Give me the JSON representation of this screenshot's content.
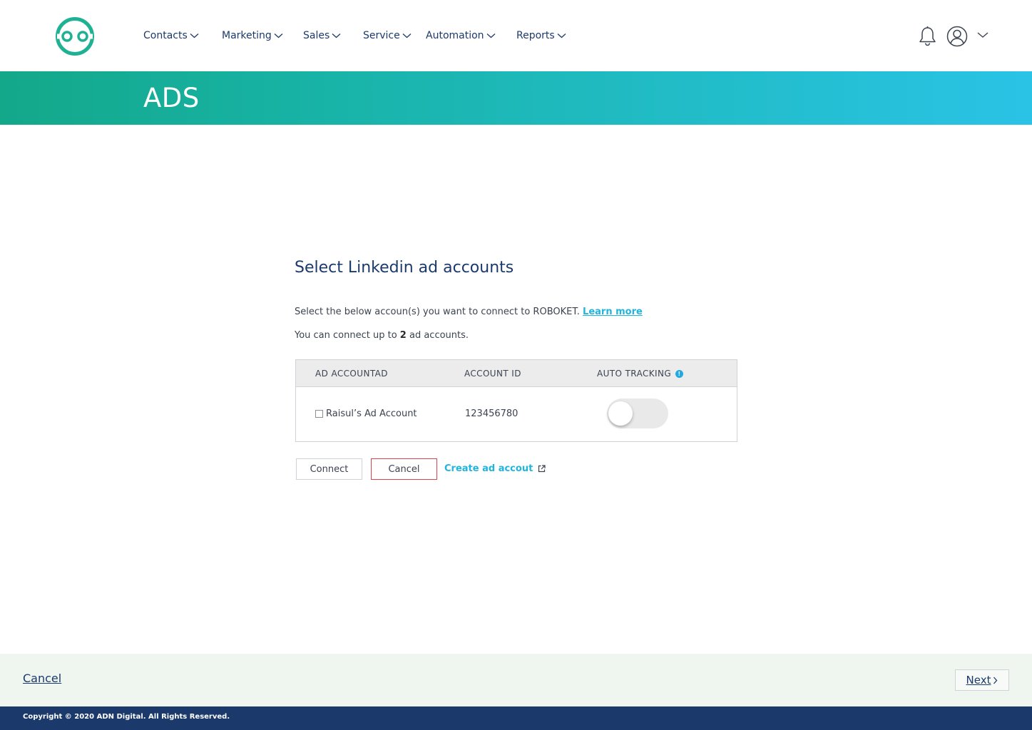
{
  "colors": {
    "brand_teal": "#13a88a",
    "brand_cyan": "#2ac3e6",
    "navy": "#1b3a6b",
    "link": "#21b5dc",
    "cancel_border": "#e0404a"
  },
  "header": {
    "logo_icon": "robot-face-logo",
    "nav": [
      {
        "label": "Contacts",
        "icon": "chevron-down-icon"
      },
      {
        "label": "Marketing",
        "icon": "chevron-down-icon"
      },
      {
        "label": "Sales",
        "icon": "chevron-down-icon"
      },
      {
        "label": "Service",
        "icon": "chevron-down-icon"
      },
      {
        "label": "Automation",
        "icon": "chevron-down-icon"
      },
      {
        "label": "Reports",
        "icon": "chevron-down-icon"
      }
    ],
    "icons": [
      "bell-icon",
      "user-avatar-icon",
      "chevron-down-icon"
    ]
  },
  "banner": {
    "title": "ADS"
  },
  "main": {
    "heading": "Select Linkedin ad accounts",
    "intro_text": "Select the below accoun(s) you want to connect to ROBOKET.",
    "learn_more": "Learn more",
    "limit_prefix": "You can connect up to",
    "limit_count": "2",
    "limit_suffix": "ad accounts.",
    "table": {
      "headers": {
        "ad_account": "AD ACCOUNTAD",
        "account_id": "ACCOUNT ID",
        "auto_tracking": "AUTO TRACKING",
        "info_icon": "info-icon"
      },
      "rows": [
        {
          "checked": false,
          "name": "Raisul’s Ad Account",
          "id": "123456780",
          "auto_tracking": false
        }
      ]
    },
    "buttons": {
      "connect": "Connect",
      "cancel": "Cancel",
      "create": "Create ad accout",
      "create_icon": "external-link-icon"
    }
  },
  "footer": {
    "cancel": "Cancel",
    "next": "Next",
    "next_icon": "chevron-right-icon",
    "copyright": "Copyright © 2020 ADN Digital. All Rights Reserved."
  }
}
